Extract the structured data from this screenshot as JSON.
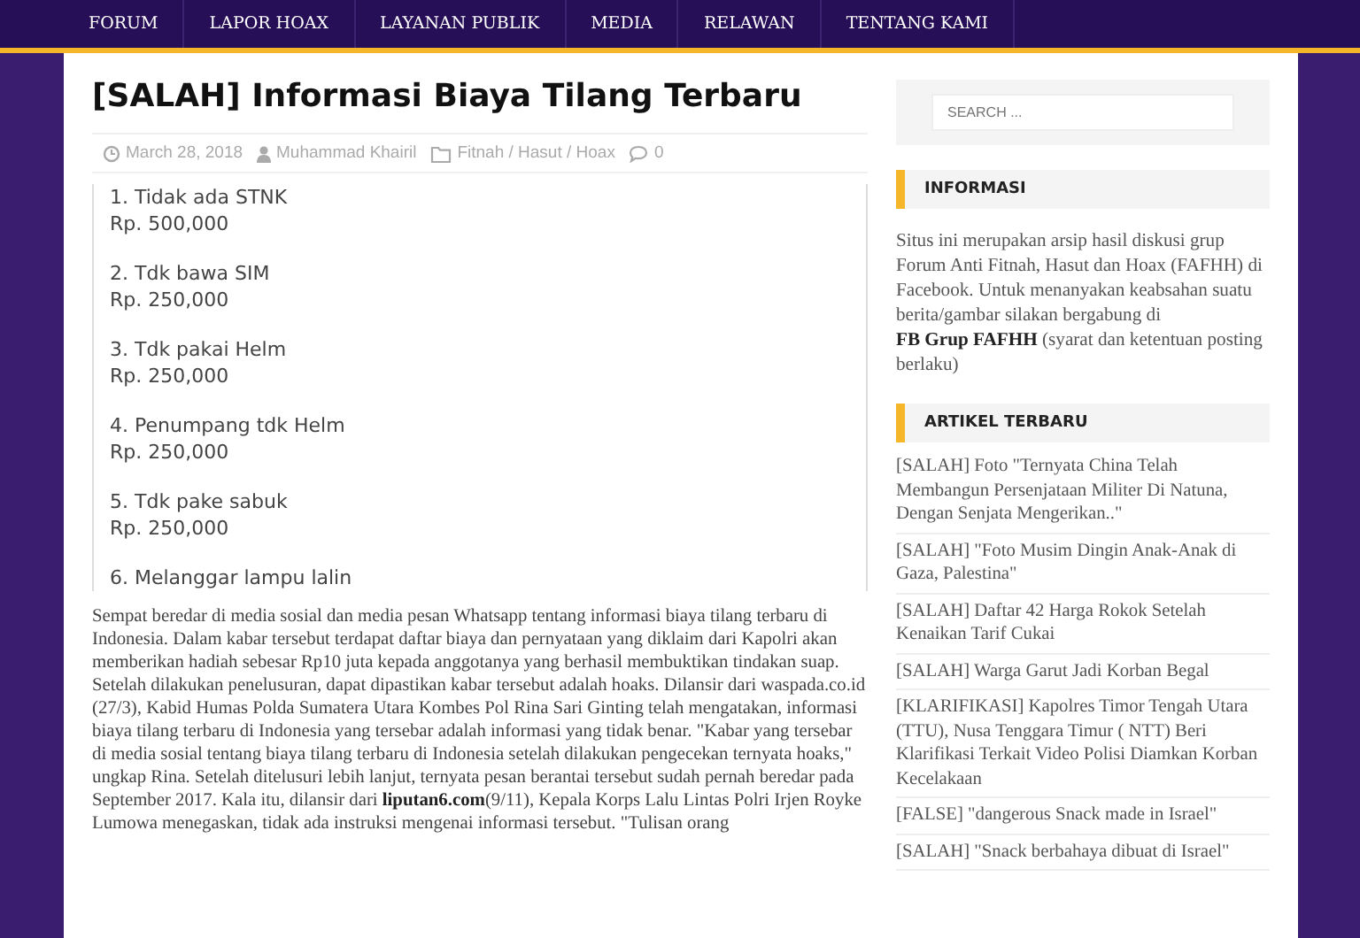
{
  "nav": {
    "items": [
      {
        "label": "FORUM"
      },
      {
        "label": "LAPOR HOAX"
      },
      {
        "label": "LAYANAN PUBLIK"
      },
      {
        "label": "MEDIA"
      },
      {
        "label": "RELAWAN"
      },
      {
        "label": "TENTANG KAMI"
      }
    ]
  },
  "article": {
    "title": "[SALAH] Informasi Biaya Tilang Terbaru",
    "meta": {
      "date": "March 28, 2018",
      "author": "Muhammad Khairil",
      "category": "Fitnah / Hasut / Hoax",
      "comments": "0"
    },
    "image_lines": [
      {
        "item": "1. Tidak ada STNK",
        "fine": "Rp. 500,000"
      },
      {
        "item": "2. Tdk bawa SIM",
        "fine": "Rp. 250,000"
      },
      {
        "item": "3. Tdk pakai Helm",
        "fine": "Rp. 250,000"
      },
      {
        "item": "4. Penumpang tdk Helm",
        "fine": "Rp. 250,000"
      },
      {
        "item": "5. Tdk pake sabuk",
        "fine": "Rp. 250,000"
      },
      {
        "item": "6. Melanggar lampu lalin"
      }
    ],
    "body": {
      "before": "Sempat beredar di media sosial dan media pesan Whatsapp tentang informasi biaya tilang terbaru di Indonesia. Dalam kabar tersebut terdapat daftar biaya dan pernyataan yang diklaim dari Kapolri akan memberikan hadiah sebesar Rp10 juta kepada anggotanya yang berhasil membuktikan tindakan suap. Setelah dilakukan penelusuran, dapat dipastikan kabar tersebut adalah hoaks. Dilansir dari waspada.co.id (27/3), Kabid Humas Polda Sumatera Utara Kombes Pol Rina Sari Ginting telah mengatakan, informasi biaya tilang terbaru di Indonesia yang tersebar adalah informasi yang tidak benar. \"Kabar yang tersebar di media sosial tentang biaya tilang terbaru di Indonesia setelah dilakukan pengecekan ternyata hoaks,\" ungkap Rina. Setelah ditelusuri lebih lanjut, ternyata pesan berantai tersebut sudah pernah beredar pada September 2017. Kala itu, dilansir dari ",
      "link": "liputan6.com",
      "after": "(9/11), Kepala Korps Lalu Lintas Polri Irjen Royke Lumowa menegaskan, tidak ada instruksi mengenai informasi tersebut. \"Tulisan orang"
    }
  },
  "sidebar": {
    "search": {
      "placeholder": "SEARCH ..."
    },
    "info": {
      "heading": "INFORMASI",
      "before": "Situs ini merupakan arsip hasil diskusi grup Forum Anti Fitnah, Hasut dan Hoax (FAFHH) di Facebook. Untuk menanyakan keabsahan suatu berita/gambar silakan bergabung di ",
      "link": "FB Grup FAFHH",
      "after": " (syarat dan ketentuan posting berlaku)"
    },
    "recent": {
      "heading": "ARTIKEL TERBARU",
      "items": [
        "[SALAH] Foto \"Ternyata China Telah Membangun Persenjataan Militer Di Natuna, Dengan Senjata Mengerikan..\"",
        "[SALAH] \"Foto Musim Dingin Anak-Anak di Gaza, Palestina\"",
        "[SALAH] Daftar 42 Harga Rokok Setelah Kenaikan Tarif Cukai",
        "[SALAH] Warga Garut Jadi Korban Begal",
        "[KLARIFIKASI] Kapolres Timor Tengah Utara (TTU), Nusa Tenggara Timur ( NTT) Beri Klarifikasi Terkait Video Polisi Diamkan Korban Kecelakaan",
        "[FALSE] \"dangerous Snack made in Israel\"",
        "[SALAH] \"Snack berbahaya dibuat di Israel\""
      ]
    }
  }
}
